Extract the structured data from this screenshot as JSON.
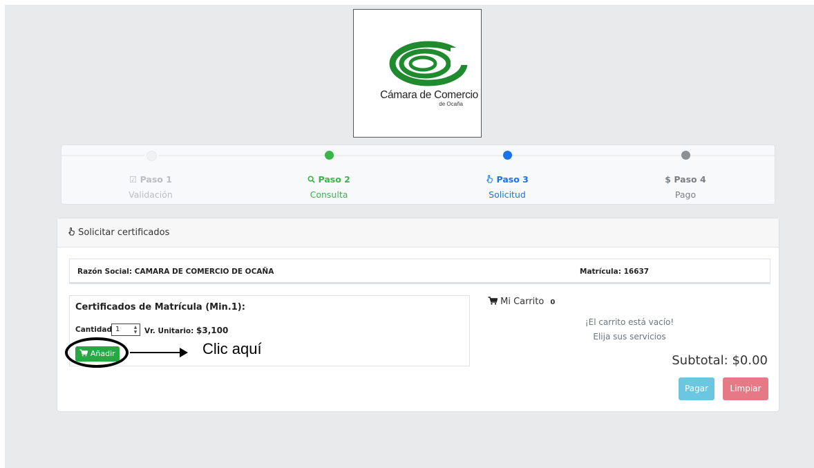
{
  "logo": {
    "name": "Cámara de Comercio",
    "subname": "de Ocaña",
    "color": "#1f8a2e"
  },
  "steps": [
    {
      "icon": "checkbox-icon",
      "glyph": "☑",
      "title": "Paso 1",
      "subtitle": "Validación",
      "state": "done",
      "color": "#b9bec3"
    },
    {
      "icon": "search-icon",
      "glyph": "",
      "title": "Paso 2",
      "subtitle": "Consulta",
      "state": "completed",
      "color": "#3bb54a"
    },
    {
      "icon": "hand-pointer-icon",
      "glyph": "",
      "title": "Paso 3",
      "subtitle": "Solicitud",
      "state": "active",
      "color": "#1a73e8"
    },
    {
      "icon": "dollar-icon",
      "glyph": "$",
      "title": "Paso 4",
      "subtitle": "Pago",
      "state": "pending",
      "color": "#7a7f85"
    }
  ],
  "panel": {
    "header": "Solicitar certificados",
    "razon_social_label": "Razón Social:",
    "razon_social_value": "CAMARA DE COMERCIO DE OCAÑA",
    "matricula_label": "Matrícula:",
    "matricula_value": "16637"
  },
  "certificate": {
    "title": "Certificados de Matrícula (Min.1):",
    "qty_label": "Cantidad:",
    "qty_value": "1",
    "price_label": "Vr. Unitario:",
    "price_value": "$3,100",
    "add_label": "Añadir"
  },
  "cart": {
    "label": "Mi Carrito",
    "count": "0",
    "empty_line1": "¡El carrito está vacío!",
    "empty_line2": "Elija sus servicios",
    "subtotal": "Subtotal: $0.00",
    "pay_label": "Pagar",
    "clear_label": "Limpiar"
  },
  "annotation": {
    "text": "Clic aquí"
  }
}
